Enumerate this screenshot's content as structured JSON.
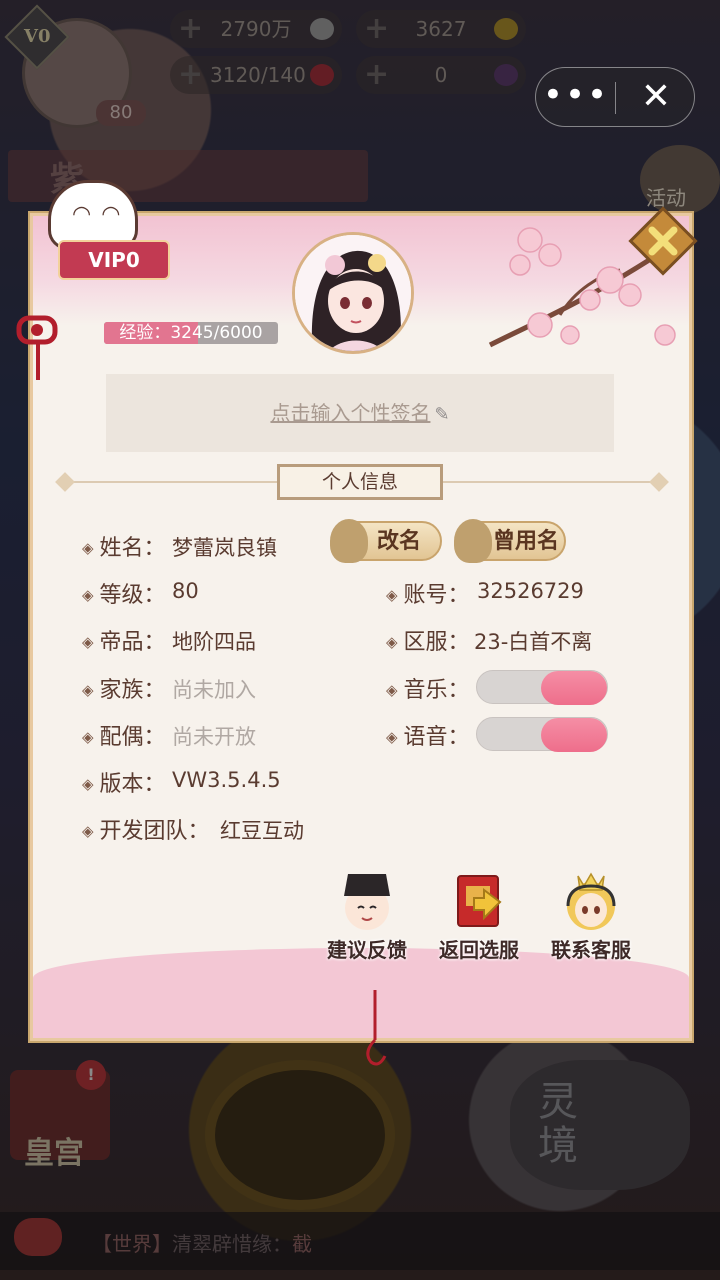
{
  "hud": {
    "vip": "V0",
    "level": "80",
    "silver": "2790万",
    "gold": "3627",
    "stamina": "3120/140",
    "gems": "0"
  },
  "banner": {
    "text": "紫"
  },
  "side": {
    "activity": "活动"
  },
  "bottom": {
    "palace": "皇宫",
    "palace_badge": "!",
    "realm": "灵境"
  },
  "chat": {
    "channel": "【世界】",
    "sender": "清翠辟惜缘：",
    "message": "截"
  },
  "profile": {
    "vip_label": "VIP0",
    "exp_text": "经验：3245/6000",
    "exp_fraction": 0.54,
    "signature_placeholder": "点击输入个性签名",
    "section_title": "个人信息",
    "fields": {
      "name_label": "姓名：",
      "name_value": "梦蕾岚良镇",
      "level_label": "等级：",
      "level_value": "80",
      "account_label": "账号：",
      "account_value": "32526729",
      "rank_label": "帝品：",
      "rank_value": "地阶四品",
      "server_label": "区服：",
      "server_value": "23-白首不离",
      "family_label": "家族：",
      "family_value": "尚未加入",
      "music_label": "音乐：",
      "spouse_label": "配偶：",
      "spouse_value": "尚未开放",
      "voice_label": "语音：",
      "version_label": "版本：",
      "version_value": "VW3.5.4.5",
      "team_label": "开发团队：",
      "team_value": "红豆互动"
    },
    "rename_button": "改名",
    "used_names_button": "曾用名",
    "music_on": true,
    "voice_on": true,
    "actions": {
      "feedback": "建议反馈",
      "back_server": "返回选服",
      "support": "联系客服"
    }
  },
  "colors": {
    "accent_pink": "#ee6e8b",
    "badge_red": "#c23a52",
    "gold_border": "#c9a46c"
  }
}
